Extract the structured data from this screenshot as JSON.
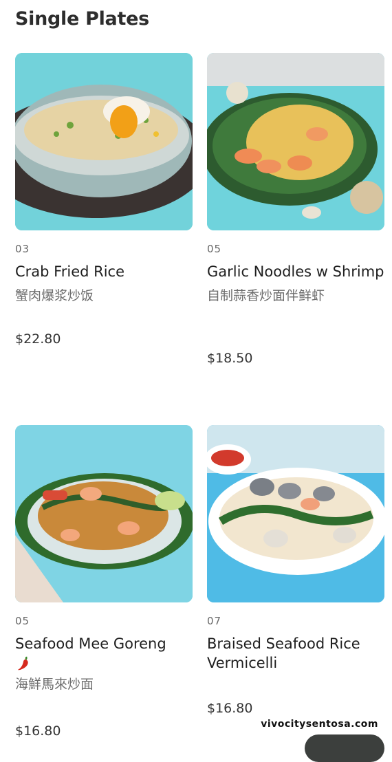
{
  "section": {
    "title": "Single Plates"
  },
  "items": [
    {
      "code": "03",
      "name": "Crab Fried Rice",
      "chinese": "蟹肉爆浆炒饭",
      "price": "$22.80",
      "image": "crab-fried-rice-photo",
      "spicy": false
    },
    {
      "code": "05",
      "name": "Garlic Noodles w Shrimp",
      "chinese": "自制蒜香炒面伴鲜虾",
      "price": "$18.50",
      "image": "garlic-noodles-photo",
      "spicy": false
    },
    {
      "code": "05",
      "name": "Seafood Mee Goreng",
      "chinese": "海鮮馬來炒面",
      "price": "$16.80",
      "image": "mee-goreng-photo",
      "spicy": true
    },
    {
      "code": "07",
      "name": "Braised Seafood Rice Vermicelli",
      "chinese": "",
      "price": "$16.80",
      "image": "rice-vermicelli-photo",
      "spicy": false
    }
  ],
  "watermark": "vivocitysentosa.com",
  "colors": {
    "tile_bg": "#6fd3dc",
    "chili": "#d62a1e"
  }
}
